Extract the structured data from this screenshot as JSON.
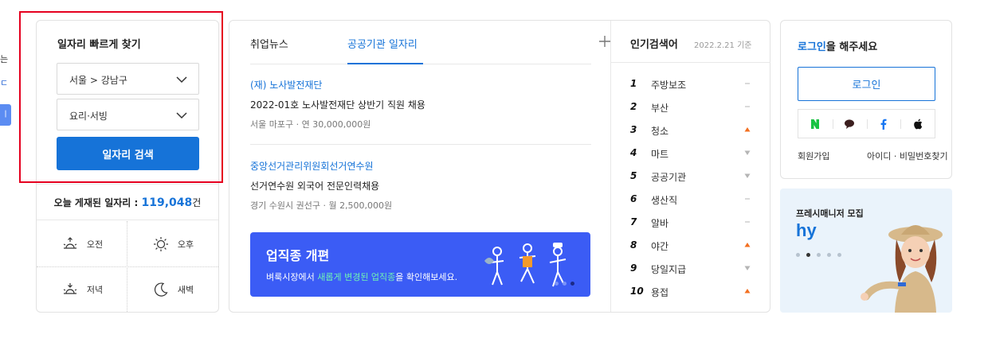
{
  "left_edge": {
    "t1": "는",
    "t2": "ㄷ",
    "pill": "ㅣ"
  },
  "job_finder": {
    "title": "일자리 빠르게 찾기",
    "region_select": "서울 > 강남구",
    "category_select": "요리·서빙",
    "search_button": "일자리 검색",
    "today_label": "오늘 게재된 일자리 : ",
    "today_count": "119,048",
    "today_unit": "건",
    "time_filters": [
      "오전",
      "오후",
      "저녁",
      "새벽"
    ]
  },
  "news": {
    "tabs": [
      "취업뉴스",
      "공공기관 일자리"
    ],
    "active_tab": "공공기관 일자리",
    "items": [
      {
        "org": "(재) 노사발전재단",
        "headline": "2022-01호 노사발전재단 상반기 직원 채용",
        "location": "서울 마포구",
        "salary": "· 연 30,000,000원"
      },
      {
        "org": "중앙선거관리위원회선거연수원",
        "headline": "선거연수원 외국어 전문인력채용",
        "location": "경기 수원시 권선구",
        "salary": "· 월 2,500,000원"
      }
    ],
    "banner": {
      "title": "업직종 개편",
      "sub_before": "벼룩시장에서 ",
      "sub_highlight": "새롭게 변경된 업직종",
      "sub_after": "을 확인해보세요."
    }
  },
  "ranking": {
    "title": "인기검색어",
    "date": "2022.2.21 기준",
    "items": [
      {
        "no": "1",
        "keyword": "주방보조",
        "trend": "same"
      },
      {
        "no": "2",
        "keyword": "부산",
        "trend": "same"
      },
      {
        "no": "3",
        "keyword": "청소",
        "trend": "up"
      },
      {
        "no": "4",
        "keyword": "마트",
        "trend": "down"
      },
      {
        "no": "5",
        "keyword": "공공기관",
        "trend": "down"
      },
      {
        "no": "6",
        "keyword": "생산직",
        "trend": "same"
      },
      {
        "no": "7",
        "keyword": "알바",
        "trend": "same"
      },
      {
        "no": "8",
        "keyword": "야간",
        "trend": "up"
      },
      {
        "no": "9",
        "keyword": "당일지급",
        "trend": "down"
      },
      {
        "no": "10",
        "keyword": "용접",
        "trend": "up"
      }
    ],
    "colors": {
      "up": "#f37021",
      "down": "#b5b5b5",
      "same": "#b5b5b5"
    }
  },
  "login": {
    "title_link": "로그인",
    "title_rest": "을 해주세요",
    "button": "로그인",
    "social": [
      "naver-icon",
      "kakao-icon",
      "facebook-icon",
      "apple-icon"
    ],
    "join": "회원가입",
    "find": "아이디 · 비밀번호찾기"
  },
  "ad": {
    "title": "프레시매니저 모집",
    "logo": "hy"
  },
  "colors": {
    "accent": "#1673d8",
    "banner": "#3b5cf5",
    "highlight_box": "#e5001f"
  }
}
